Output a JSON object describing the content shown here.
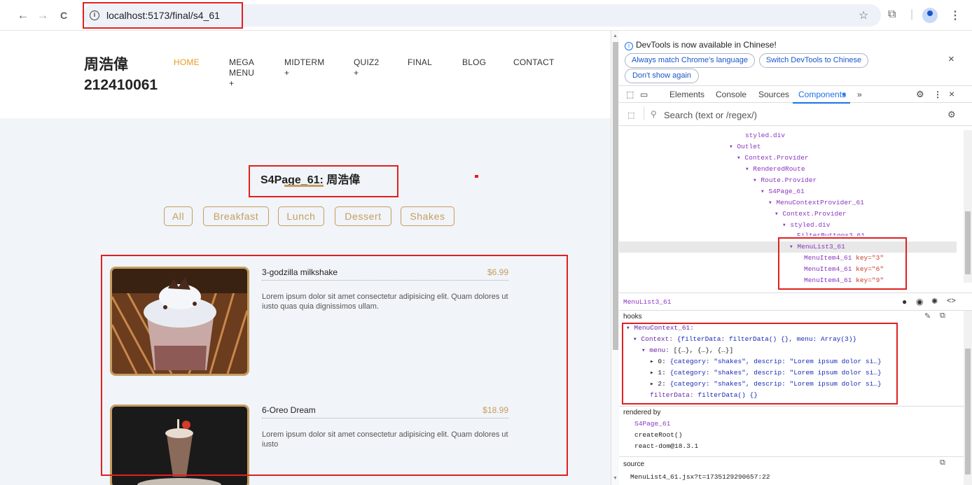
{
  "browser": {
    "url": "localhost:5173/final/s4_61",
    "back_icon": "←",
    "forward_icon": "→",
    "reload_icon": "C",
    "star_icon": "☆",
    "extensions_icon": "⧉",
    "menu_icon": "⋮",
    "close_icon": "×"
  },
  "site": {
    "brand_line1": "周浩偉",
    "brand_line2": "212410061",
    "nav": [
      {
        "label": "HOME",
        "sub": "",
        "active": true
      },
      {
        "label": "MEGA",
        "sub": "MENU",
        "plus": "+"
      },
      {
        "label": "MIDTERM",
        "plus": "+"
      },
      {
        "label": "QUIZ2",
        "plus": "+"
      },
      {
        "label": "FINAL"
      },
      {
        "label": "BLOG"
      },
      {
        "label": "CONTACT"
      }
    ],
    "page_title": "S4Page_61: 周浩偉",
    "filters": [
      "All",
      "Breakfast",
      "Lunch",
      "Dessert",
      "Shakes"
    ],
    "items": [
      {
        "name": "3-godzilla milkshake",
        "price": "$6.99",
        "desc": "Lorem ipsum dolor sit amet consectetur adipisicing elit. Quam dolores ut iusto quas quia dignissimos ullam."
      },
      {
        "name": "6-Oreo Dream",
        "price": "$18.99",
        "desc": "Lorem ipsum dolor sit amet consectetur adipisicing elit. Quam dolores ut iusto"
      }
    ]
  },
  "devtools": {
    "banner": "DevTools is now available in Chinese!",
    "btn_match": "Always match Chrome's language",
    "btn_switch": "Switch DevTools to Chinese",
    "btn_dont_show": "Don't show again",
    "tabs": [
      "Elements",
      "Console",
      "Sources",
      "Components",
      "»"
    ],
    "more_tabs": "»",
    "search_placeholder": "Search (text or /regex/)",
    "tree": {
      "r0": "styled.div",
      "r1": "▾ Outlet",
      "r2": "▾ Context.Provider",
      "r3": "▾ RenderedRoute",
      "r4": "▾ Route.Provider",
      "r5": "▾ S4Page_61",
      "r6": "▾ MenuContextProvider_61",
      "r7": "▾ Context.Provider",
      "r8": "▾ styled.div",
      "r9": "FilterButtons3_61",
      "r10": "▾ MenuList3_61",
      "c1": "MenuItem4_61",
      "key_attr": "key",
      "k1": "=\"3\"",
      "k2": "=\"6\"",
      "k3": "=\"9\""
    },
    "selected_component": "MenuList3_61",
    "hooks_label": "hooks",
    "hooks": {
      "h0": "▾ MenuContext_61:",
      "h1_key": "▾ Context:",
      "h1_val": "{filterData: filterData() {}, menu: Array(3)}",
      "h2_key": "▾ menu:",
      "h2_val": "[{…}, {…}, {…}]",
      "h3_key": "▸ 0:",
      "h3_val": "{category: \"shakes\", descrip: \"Lorem ipsum dolor si…}",
      "h4_key": "▸ 1:",
      "h4_val": "{category: \"shakes\", descrip: \"Lorem ipsum dolor si…}",
      "h5_key": "▸ 2:",
      "h5_val": "{category: \"shakes\", descrip: \"Lorem ipsum dolor si…}",
      "h6_key": "filterData:",
      "h6_val": "filterData() {}"
    },
    "rendered_by_label": "rendered by",
    "rendered_by": [
      "S4Page_61",
      "createRoot()",
      "react-dom@18.3.1"
    ],
    "source_label": "source",
    "source_file": "MenuList4_61.jsx?t=1735129290657:22"
  }
}
